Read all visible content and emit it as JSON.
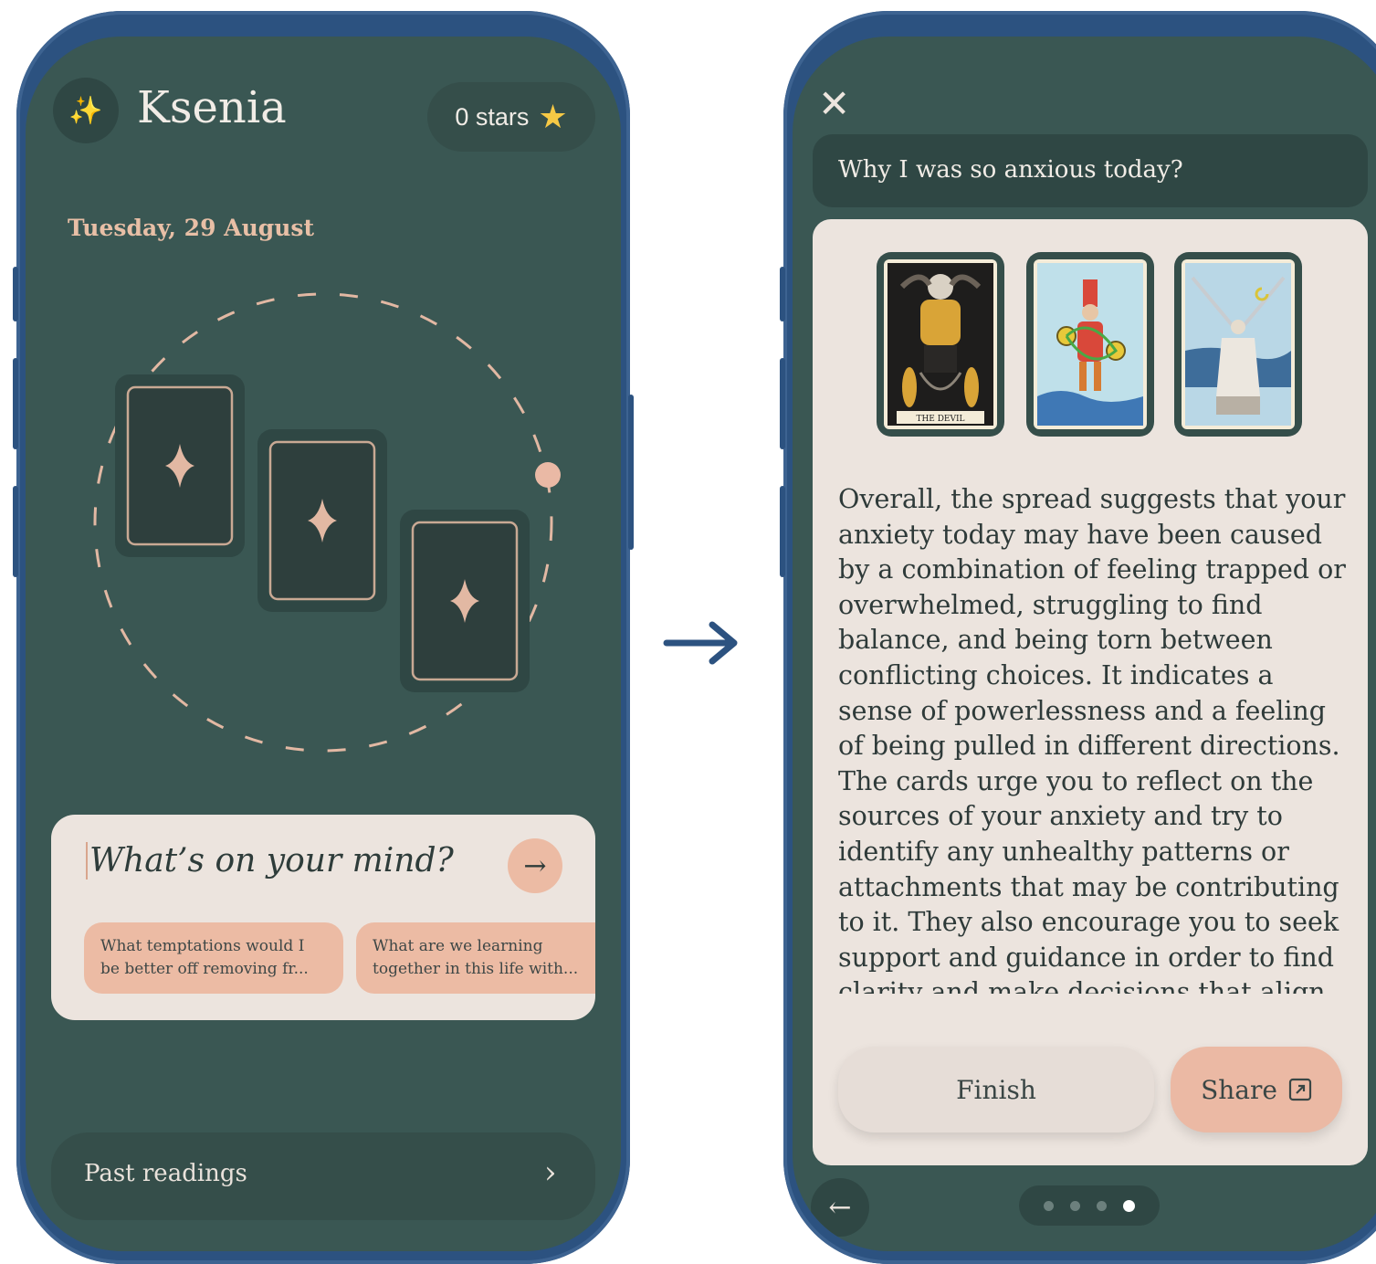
{
  "home": {
    "user_name": "Ksenia",
    "stars_label": "0 stars",
    "date": "Tuesday, 29 August",
    "mind_placeholder": "What’s on your mind?",
    "suggestions": [
      {
        "line1": "What temptations would I",
        "line2": "be better off removing fr..."
      },
      {
        "line1": "What are we learning",
        "line2": "together in this life with..."
      }
    ],
    "past_readings": "Past readings"
  },
  "reading": {
    "question": "Why I was so anxious today?",
    "cards": [
      {
        "label": "THE DEVIL",
        "icon": "devil-card"
      },
      {
        "label": "",
        "icon": "two-of-pentacles-card"
      },
      {
        "label": "",
        "icon": "two-of-swords-card"
      }
    ],
    "interpretation": "Overall, the spread suggests that your anxiety today may have been caused by a combination of feeling trapped or overwhelmed, struggling to find balance, and being torn between conflicting choices. It indicates a sense of powerlessness and a feeling of being pulled in different directions. The cards urge you to reflect on the sources of your anxiety and try to identify any unhealthy patterns or attachments that may be contributing to it. They also encourage you to seek support and guidance in order to find clarity and make decisions that align",
    "finish_label": "Finish",
    "share_label": "Share",
    "pages_total": 4,
    "pages_active": 4
  },
  "colors": {
    "screen_bg": "#3a5753",
    "card_bg": "#ece4de",
    "accent_peach": "#ecbba4",
    "frame_blue": "#2c5280",
    "text_light": "#f1ece6"
  }
}
